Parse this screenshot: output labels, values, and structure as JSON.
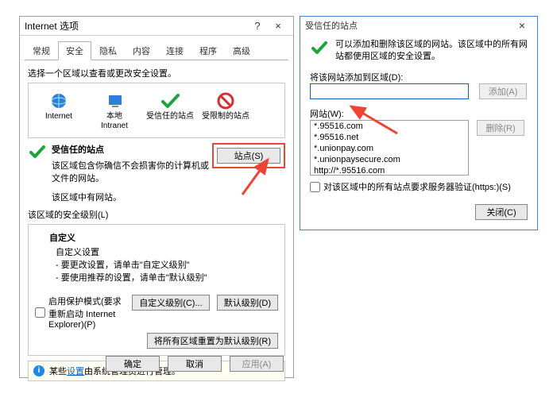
{
  "internetOptions": {
    "title": "Internet 选项",
    "helpSymbol": "?",
    "closeSymbol": "×",
    "tabs": [
      "常规",
      "安全",
      "隐私",
      "内容",
      "连接",
      "程序",
      "高级"
    ],
    "activeTabIndex": 1,
    "zonePrompt": "选择一个区域以查看或更改安全设置。",
    "zones": {
      "internet": "Internet",
      "localIntranet": "本地\nIntranet",
      "trusted": "受信任的站点",
      "restricted": "受限制的站点"
    },
    "trustedHeading": "受信任的站点",
    "trustedDesc": "该区域包含你确信不会损害你的计算机或文件的网站。",
    "trustedNote": "该区域中有网站。",
    "sitesButton": "站点(S)",
    "securityLevelLabel": "该区域的安全级别(L)",
    "customHeading": "自定义",
    "customLine1": "自定义设置",
    "customLine2": "- 要更改设置，请单击\"自定义级别\"",
    "customLine3": "- 要使用推荐的设置，请单击\"默认级别\"",
    "enableProtected": "启用保护模式(要求重新启动 Internet Explorer)(P)",
    "customLevelBtn": "自定义级别(C)...",
    "defaultLevelBtn": "默认级别(D)",
    "resetAllBtn": "将所有区域重置为默认级别(R)",
    "infoPrefix": "某些",
    "infoLink": "设置",
    "infoSuffix": "由系统管理员进行管理。",
    "ok": "确定",
    "cancel": "取消",
    "apply": "应用(A)"
  },
  "trustedSites": {
    "title": "受信任的站点",
    "closeSymbol": "×",
    "desc": "可以添加和删除该区域的网站。该区域中的所有网站都使用区域的安全设置。",
    "addLabel": "将该网站添加到区域(D):",
    "addBtn": "添加(A)",
    "sitesLabel": "网站(W):",
    "sites": [
      "*.95516.com",
      "*.95516.net",
      "*.unionpay.com",
      "*.unionpaysecure.com",
      "http://*.95516.com"
    ],
    "deleteBtn": "删除(R)",
    "httpsVerify": "对该区域中的所有站点要求服务器验证(https:)(S)",
    "closeBtn": "关闭(C)"
  }
}
